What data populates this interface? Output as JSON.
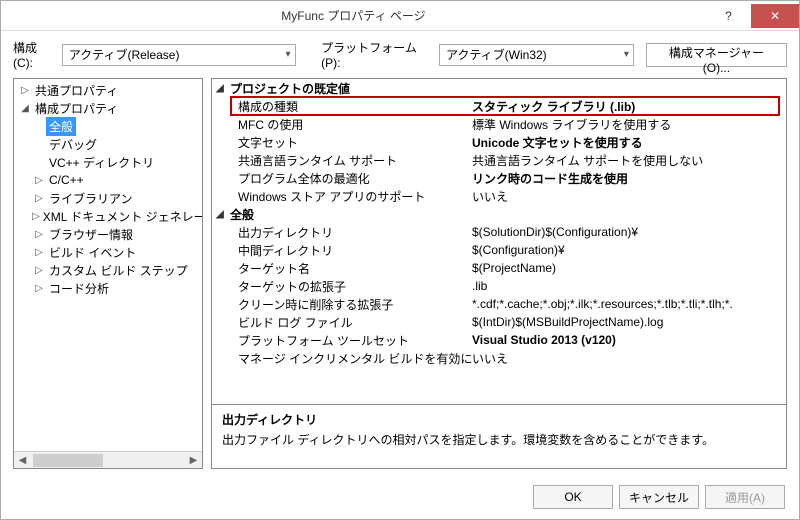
{
  "window": {
    "title": "MyFunc プロパティ ページ"
  },
  "config": {
    "config_label": "構成(C):",
    "config_value": "アクティブ(Release)",
    "platform_label": "プラットフォーム(P):",
    "platform_value": "アクティブ(Win32)",
    "manager_btn": "構成マネージャー(O)..."
  },
  "tree": {
    "items": [
      {
        "label": "共通プロパティ",
        "level": 0,
        "expander": "▷"
      },
      {
        "label": "構成プロパティ",
        "level": 0,
        "expander": "◢"
      },
      {
        "label": "全般",
        "level": 1,
        "selected": true
      },
      {
        "label": "デバッグ",
        "level": 1
      },
      {
        "label": "VC++ ディレクトリ",
        "level": 1
      },
      {
        "label": "C/C++",
        "level": 1,
        "expander": "▷"
      },
      {
        "label": "ライブラリアン",
        "level": 1,
        "expander": "▷"
      },
      {
        "label": "XML ドキュメント ジェネレーター",
        "level": 1,
        "expander": "▷"
      },
      {
        "label": "ブラウザー情報",
        "level": 1,
        "expander": "▷"
      },
      {
        "label": "ビルド イベント",
        "level": 1,
        "expander": "▷"
      },
      {
        "label": "カスタム ビルド ステップ",
        "level": 1,
        "expander": "▷"
      },
      {
        "label": "コード分析",
        "level": 1,
        "expander": "▷"
      }
    ]
  },
  "groups": [
    {
      "header": "プロジェクトの既定値",
      "rows": [
        {
          "name": "構成の種類",
          "value": "スタティック ライブラリ (.lib)",
          "bold": true,
          "highlight": true
        },
        {
          "name": "MFC の使用",
          "value": "標準 Windows ライブラリを使用する"
        },
        {
          "name": "文字セット",
          "value": "Unicode 文字セットを使用する",
          "bold": true
        },
        {
          "name": "共通言語ランタイム サポート",
          "value": "共通言語ランタイム サポートを使用しない"
        },
        {
          "name": "プログラム全体の最適化",
          "value": "リンク時のコード生成を使用",
          "bold": true
        },
        {
          "name": "Windows ストア アプリのサポート",
          "value": "いいえ"
        }
      ]
    },
    {
      "header": "全般",
      "rows": [
        {
          "name": "出力ディレクトリ",
          "value": "$(SolutionDir)$(Configuration)¥"
        },
        {
          "name": "中間ディレクトリ",
          "value": "$(Configuration)¥"
        },
        {
          "name": "ターゲット名",
          "value": "$(ProjectName)"
        },
        {
          "name": "ターゲットの拡張子",
          "value": ".lib"
        },
        {
          "name": "クリーン時に削除する拡張子",
          "value": "*.cdf;*.cache;*.obj;*.ilk;*.resources;*.tlb;*.tli;*.tlh;*."
        },
        {
          "name": "ビルド ログ ファイル",
          "value": "$(IntDir)$(MSBuildProjectName).log"
        },
        {
          "name": "プラットフォーム ツールセット",
          "value": "Visual Studio 2013 (v120)",
          "bold": true
        },
        {
          "name": "マネージ インクリメンタル ビルドを有効にする",
          "value": "いいえ"
        }
      ]
    }
  ],
  "desc": {
    "title": "出力ディレクトリ",
    "text": "出力ファイル ディレクトリへの相対パスを指定します。環境変数を含めることができます。"
  },
  "buttons": {
    "ok": "OK",
    "cancel": "キャンセル",
    "apply": "適用(A)"
  }
}
